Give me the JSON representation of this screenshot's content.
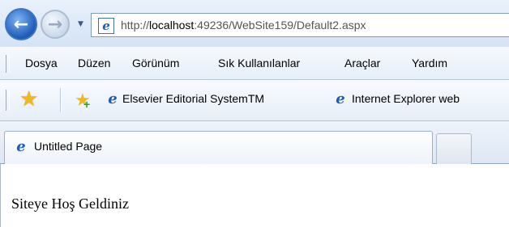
{
  "address_bar": {
    "back_glyph": "←",
    "forward_glyph": "→",
    "dropdown_glyph": "▼",
    "url_prefix": "http://",
    "url_host": "localhost",
    "url_rest": ":49236/WebSite159/Default2.aspx",
    "site_icon": "ie-logo-icon"
  },
  "menu": {
    "items": [
      "Dosya",
      "Düzen",
      "Görünüm",
      "Sık Kullanılanlar",
      "Araçlar",
      "Yardım"
    ]
  },
  "favorites_bar": {
    "star_glyph": "★",
    "links": [
      "Elsevier Editorial SystemTM",
      "Internet Explorer web"
    ]
  },
  "tabs": {
    "active_title": "Untitled Page"
  },
  "page": {
    "text": "Siteye Hoş Geldiniz"
  },
  "colors": {
    "accent": "#1d5bb8",
    "star": "#f1b722"
  }
}
